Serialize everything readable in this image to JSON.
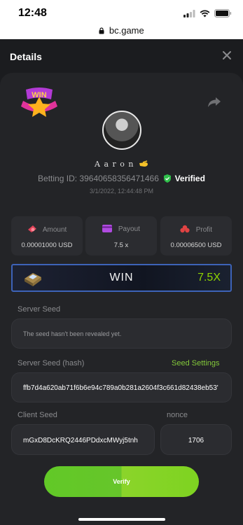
{
  "status_bar": {
    "time": "12:48",
    "url": "bc.game"
  },
  "header": {
    "title": "Details"
  },
  "user": {
    "name": "A a r o n",
    "betting_id_label": "Betting ID:",
    "betting_id": "39640658356471466",
    "verified_label": "Verified",
    "datetime": "3/1/2022, 12:44:48 PM"
  },
  "stats": [
    {
      "label": "Amount",
      "value": "0.00001000 USD",
      "icon": "amount-icon",
      "color": "#e04358"
    },
    {
      "label": "Payout",
      "value": "7.5 x",
      "icon": "payout-icon",
      "color": "#b04be0"
    },
    {
      "label": "Profit",
      "value": "0.00006500 USD",
      "icon": "profit-icon",
      "color": "#e04343"
    }
  ],
  "result": {
    "label": "WIN",
    "multiplier": "7.5X"
  },
  "server_seed": {
    "label": "Server Seed",
    "value": "The seed hasn't been revealed yet."
  },
  "server_seed_hash": {
    "label": "Server Seed (hash)",
    "settings_link": "Seed Settings",
    "value": "ffb7d4a620ab71f6b6e94c789a0b281a2604f3c661d82438eb53'"
  },
  "client_seed": {
    "label": "Client Seed",
    "value": "mGxD8DcKRQ2446PDdxcMWyj5tnh"
  },
  "nonce": {
    "label": "nonce",
    "value": "1706"
  },
  "verify_button": {
    "label": "Verify"
  },
  "colors": {
    "accent_green": "#7ed321",
    "background": "#1b1c1f",
    "card": "#232427",
    "win_border": "#3d63b8"
  }
}
